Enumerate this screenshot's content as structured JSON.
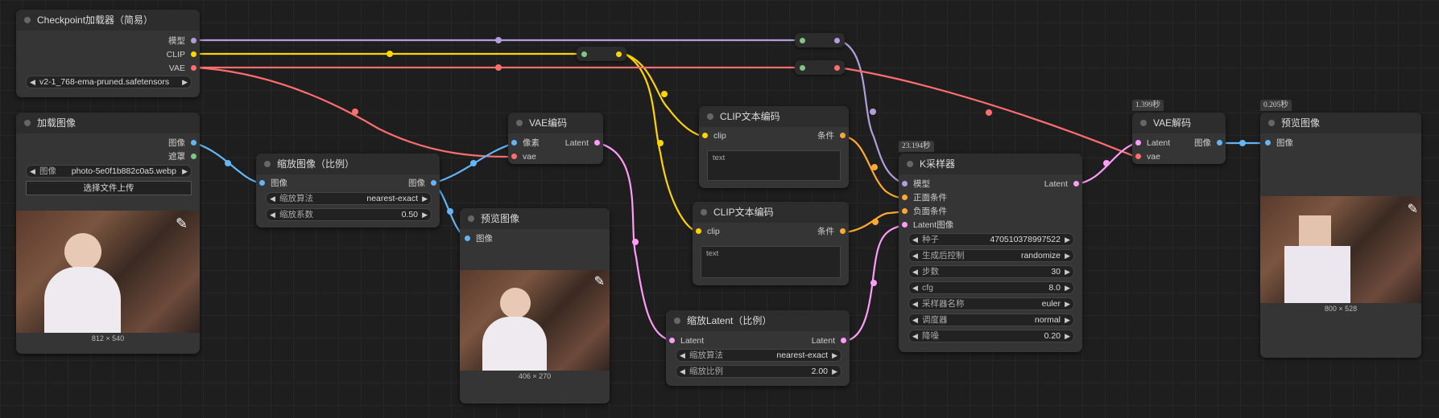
{
  "colors": {
    "model": "#b39ddb",
    "clip": "#ffd500",
    "vae": "#ff6e6e",
    "image": "#64b5f6",
    "mask": "#81c784",
    "latent": "#ff9cf9",
    "cond": "#ffa931"
  },
  "ckpt": {
    "title": "Checkpoint加载器（简易）",
    "out_model": "模型",
    "out_clip": "CLIP",
    "out_vae": "VAE",
    "ckpt_name": "v2-1_768-ema-pruned.safetensors"
  },
  "loadimg": {
    "title": "加载图像",
    "out_image": "图像",
    "out_mask": "遮罩",
    "image_label": "图像",
    "image_value": "photo-5e0f1b882c0a5.webp",
    "upload_label": "选择文件上传",
    "size": "812 × 540"
  },
  "scale": {
    "title": "缩放图像（比例）",
    "in_image": "图像",
    "out_image": "图像",
    "method_label": "缩放算法",
    "method_value": "nearest-exact",
    "factor_label": "缩放系数",
    "factor_value": "0.50"
  },
  "vaeenc": {
    "title": "VAE编码",
    "in_pixels": "像素",
    "in_vae": "vae",
    "out_latent": "Latent"
  },
  "preview1": {
    "title": "预览图像",
    "in_image": "图像",
    "size": "406 × 270"
  },
  "clip1": {
    "title": "CLIP文本编码",
    "in_clip": "clip",
    "out_cond": "条件",
    "text": "text"
  },
  "clip2": {
    "title": "CLIP文本编码",
    "in_clip": "clip",
    "out_cond": "条件",
    "text": "text"
  },
  "latentscale": {
    "title": "缩放Latent（比例）",
    "in_latent": "Latent",
    "out_latent": "Latent",
    "method_label": "缩放算法",
    "method_value": "nearest-exact",
    "factor_label": "缩放比例",
    "factor_value": "2.00"
  },
  "ksampler": {
    "badge": "23.194秒",
    "title": "K采样器",
    "in_model": "模型",
    "in_pos": "正面条件",
    "in_neg": "负面条件",
    "in_latent": "Latent图像",
    "out_latent": "Latent",
    "widgets": [
      {
        "label": "种子",
        "value": "470510378997522"
      },
      {
        "label": "生成后控制",
        "value": "randomize"
      },
      {
        "label": "步数",
        "value": "30"
      },
      {
        "label": "cfg",
        "value": "8.0"
      },
      {
        "label": "采样器名称",
        "value": "euler"
      },
      {
        "label": "调度器",
        "value": "normal"
      },
      {
        "label": "降噪",
        "value": "0.20"
      }
    ]
  },
  "vaedec": {
    "badge": "1.399秒",
    "title": "VAE解码",
    "in_latent": "Latent",
    "in_vae": "vae",
    "out_image": "图像"
  },
  "preview2": {
    "badge": "0.205秒",
    "title": "预览图像",
    "in_image": "图像",
    "size": "800 × 528"
  }
}
